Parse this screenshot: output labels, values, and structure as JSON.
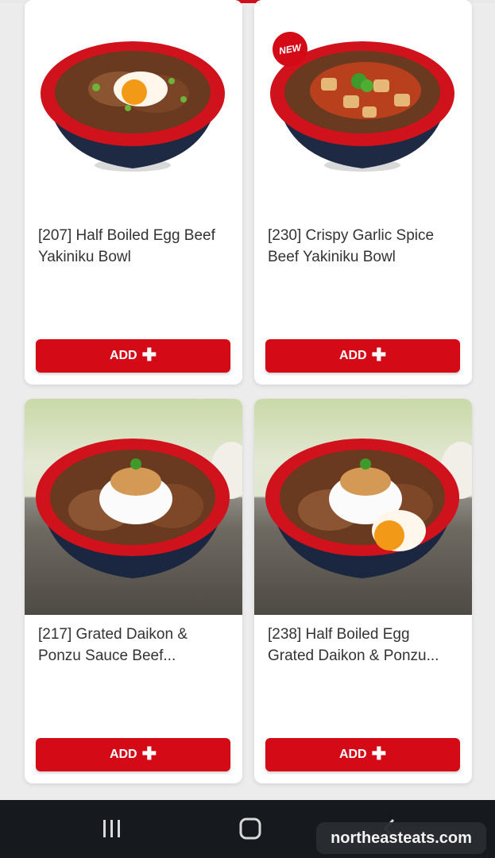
{
  "menu": {
    "items": [
      {
        "title": "[207] Half Boiled Egg Beef\nYakiniku Bowl",
        "button_label": "ADD",
        "is_new": false
      },
      {
        "title": "[230] Crispy Garlic Spice\nBeef Yakiniku Bowl",
        "button_label": "ADD",
        "is_new": true,
        "badge": "NEW"
      },
      {
        "title": "[217] Grated Daikon &\nPonzu Sauce Beef...",
        "button_label": "ADD",
        "is_new": false
      },
      {
        "title": "[238] Half Boiled Egg\nGrated Daikon & Ponzu...",
        "button_label": "ADD",
        "is_new": false
      }
    ]
  },
  "icons": {
    "add": "plus-icon",
    "recent": "recent-apps-icon",
    "home": "home-icon",
    "back": "back-icon"
  },
  "colors": {
    "accent": "#d50a17",
    "bowl_red": "#d0121c",
    "bowl_navy": "#1e2a44"
  },
  "watermark": "northeasteats.com"
}
